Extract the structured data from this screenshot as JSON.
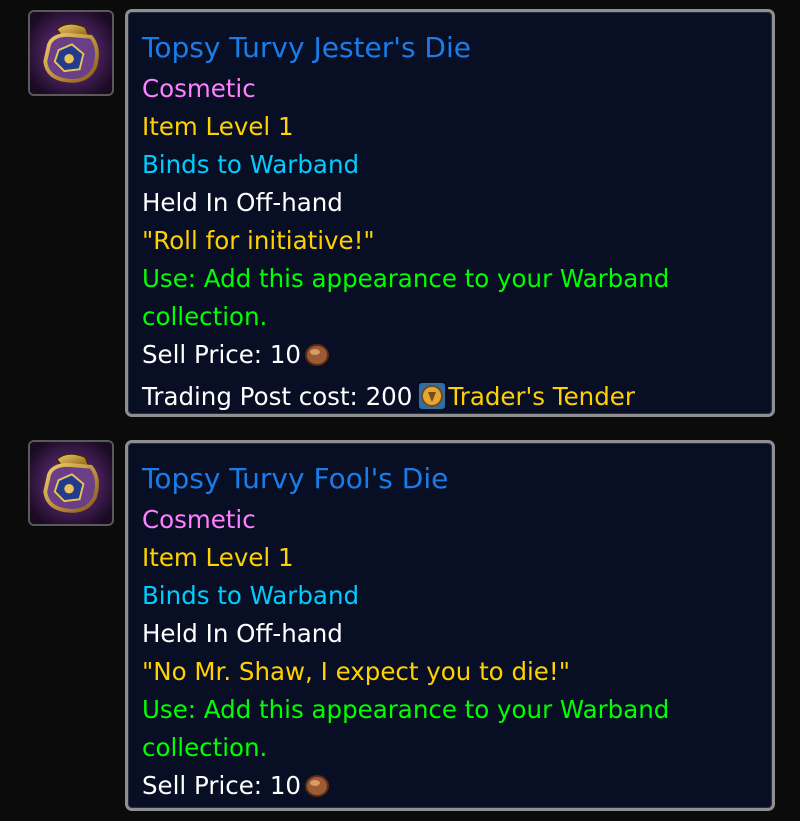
{
  "tooltips": [
    {
      "name": "Topsy Turvy Jester's Die",
      "cosmetic": "Cosmetic",
      "item_level": "Item Level 1",
      "binds": "Binds to Warband",
      "slot": "Held In Off-hand",
      "flavor": "\"Roll for initiative!\"",
      "use": "Use: Add this appearance to your Warband collection.",
      "sell_price_label": "Sell Price: 10",
      "sell_price_icon": "copper-coin-icon",
      "trading_post_label": "Trading Post cost: 200",
      "trading_post_currency": "Trader's Tender",
      "trading_post_icon": "traders-tender-icon"
    },
    {
      "name": "Topsy Turvy Fool's Die",
      "cosmetic": "Cosmetic",
      "item_level": "Item Level 1",
      "binds": "Binds to Warband",
      "slot": "Held In Off-hand",
      "flavor": "\"No Mr. Shaw, I expect you to die!\"",
      "use": "Use: Add this appearance to your Warband collection.",
      "sell_price_label": "Sell Price: 10",
      "sell_price_icon": "copper-coin-icon"
    }
  ],
  "item_icon": "dice-bag-icon",
  "colors": {
    "item_name": "#1a7ce8",
    "cosmetic": "#ff80ff",
    "item_level": "#ffd100",
    "binds": "#00ccff",
    "flavor": "#ffd100",
    "use": "#00ff00",
    "tooltip_bg": "#080f24",
    "tooltip_border": "#8f8f8f"
  }
}
